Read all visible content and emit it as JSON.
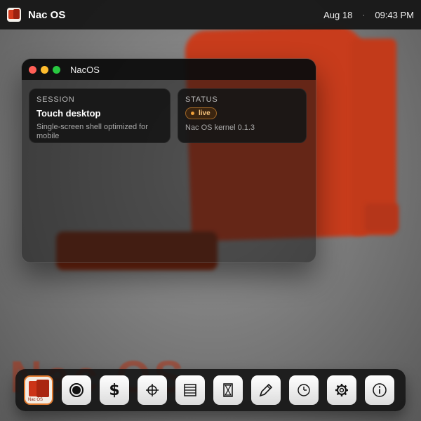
{
  "menubar": {
    "app_title": "Nac OS",
    "date": "Aug 18",
    "separator": "·",
    "time": "09:43 PM"
  },
  "wallpaper": {
    "text": "Nac OS",
    "accent_color": "#c83c1c"
  },
  "window": {
    "title": "NacOS",
    "session": {
      "label": "SESSION",
      "heading": "Touch desktop",
      "description": "Single-screen shell optimized for mobile"
    },
    "status": {
      "label": "STATUS",
      "badge": "live",
      "kernel": "Nac OS kernel 0.1.3"
    }
  },
  "dock": {
    "items": [
      {
        "icon": "nacos-app-icon",
        "tiny_label": "Nac OS"
      },
      {
        "icon": "record-icon"
      },
      {
        "icon": "dollar-icon",
        "glyph": "$"
      },
      {
        "icon": "crosshair-icon"
      },
      {
        "icon": "list-icon"
      },
      {
        "icon": "hourglass-icon"
      },
      {
        "icon": "pencil-icon"
      },
      {
        "icon": "clock-icon"
      },
      {
        "icon": "gear-icon"
      },
      {
        "icon": "info-icon"
      }
    ]
  },
  "colors": {
    "menubar_bg": "#181818",
    "badge_text": "#f6c57e",
    "badge_dot": "#f0a13a"
  }
}
